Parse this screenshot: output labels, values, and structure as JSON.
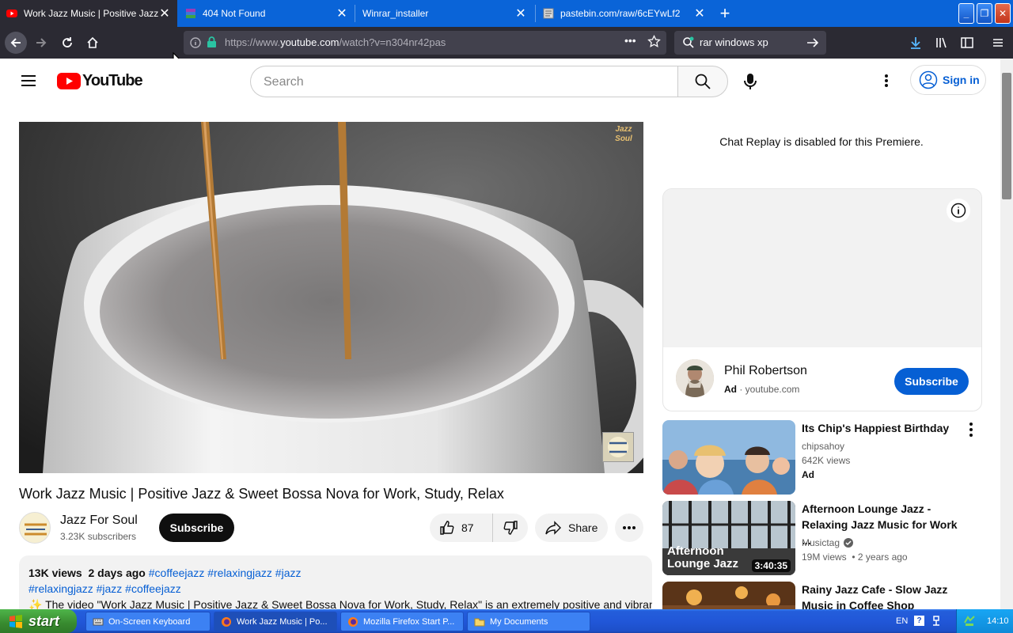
{
  "browser": {
    "tabs": [
      {
        "title": "Work Jazz Music | Positive Jazz & S",
        "active": true
      },
      {
        "title": "404 Not Found",
        "active": false
      },
      {
        "title": "Winrar_installer",
        "active": false
      },
      {
        "title": "pastebin.com/raw/6cEYwLf2",
        "active": false
      }
    ],
    "url_prefix": "https://www.",
    "url_domain": "youtube.com",
    "url_path": "/watch?v=n304nr42pas",
    "search_query": "rar windows xp"
  },
  "youtube": {
    "logo_text": "YouTube",
    "search_placeholder": "Search",
    "signin_label": "Sign in"
  },
  "video": {
    "watermark": "Jazz Soul",
    "title": "Work Jazz Music | Positive Jazz & Sweet Bossa Nova for Work, Study, Relax",
    "channel_name": "Jazz For Soul",
    "channel_subs": "3.23K subscribers",
    "subscribe_label": "Subscribe",
    "likes": "87",
    "share_label": "Share",
    "views_date": "13K views  2 days ago",
    "tags_line1": "#coffeejazz #relaxingjazz #jazz",
    "tags_line2": "#relaxingjazz #jazz #coffeejazz",
    "description": "The video \"Work Jazz Music | Positive Jazz & Sweet Bossa Nova for Work, Study, Relax\" is an extremely positive and vibrant"
  },
  "sidebar": {
    "chat_replay": "Chat Replay is disabled for this Premiere.",
    "ad": {
      "name": "Phil Robertson",
      "label": "Ad",
      "domain": "youtube.com",
      "subscribe_label": "Subscribe"
    },
    "recommendations": [
      {
        "title": "Its Chip's Happiest Birthday",
        "channel": "chipsahoy",
        "meta": "642K views",
        "ad": "Ad",
        "duration": ""
      },
      {
        "title": "Afternoon Lounge Jazz - Relaxing Jazz Music for Work ...",
        "channel": "Musictag",
        "meta": "19M views  • 2 years ago",
        "ad": "",
        "duration": "3:40:35",
        "thumb_text": "Afternoon Lounge Jazz"
      },
      {
        "title": "Rainy Jazz Cafe - Slow Jazz Music in Coffee Shop Ambien...",
        "channel": "",
        "meta": "",
        "ad": "",
        "duration": ""
      }
    ]
  },
  "taskbar": {
    "start_label": "start",
    "items": [
      {
        "label": "On-Screen Keyboard",
        "active": false
      },
      {
        "label": "Work Jazz Music | Po...",
        "active": true
      },
      {
        "label": "Mozilla Firefox Start P...",
        "active": false
      },
      {
        "label": "My Documents",
        "active": false
      }
    ],
    "lang": "EN",
    "clock": "14:10"
  },
  "colors": {
    "firefox_dark": "#2b2a33",
    "xp_blue": "#245edb",
    "yt_red": "#ff0000",
    "yt_link": "#065fd4"
  }
}
